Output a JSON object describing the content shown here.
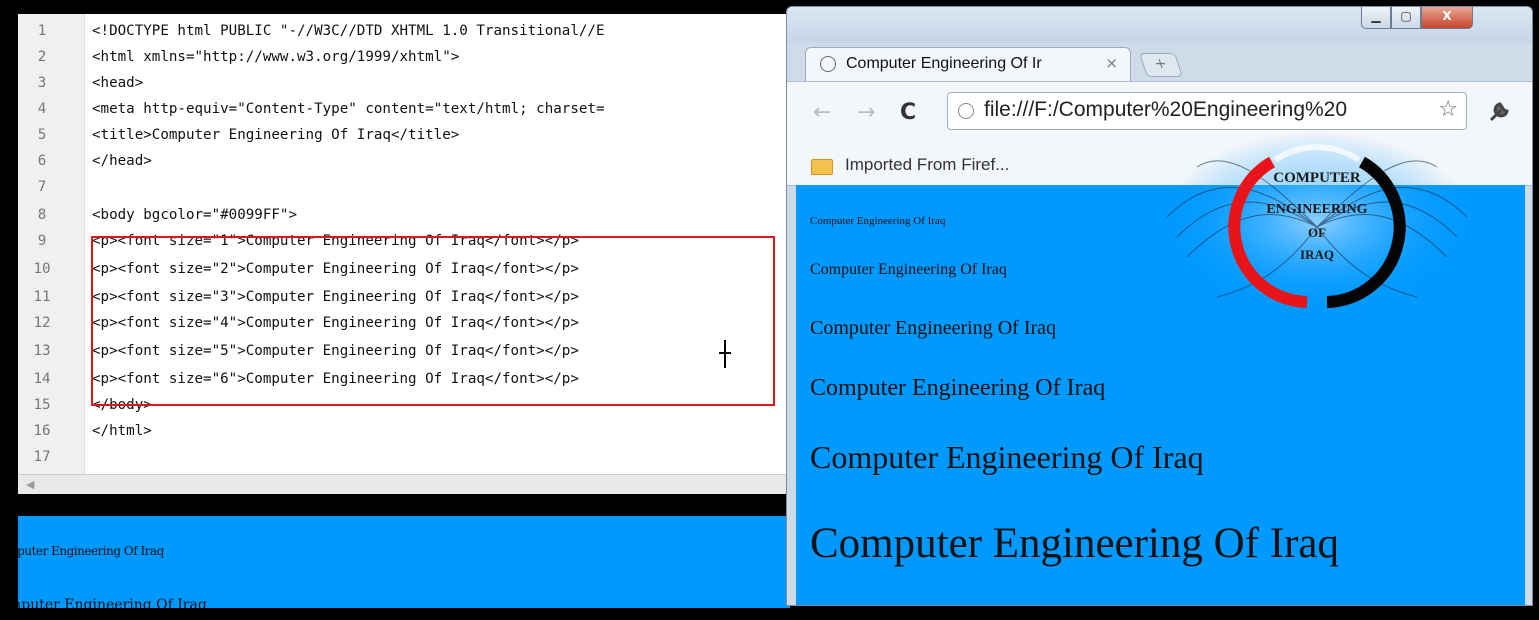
{
  "editor": {
    "lines": [
      {
        "num": "1",
        "text": "<!DOCTYPE html PUBLIC \"-//W3C//DTD XHTML 1.0 Transitional//E"
      },
      {
        "num": "2",
        "text": "<html xmlns=\"http://www.w3.org/1999/xhtml\">"
      },
      {
        "num": "3",
        "text": "<head>"
      },
      {
        "num": "4",
        "text": "<meta http-equiv=\"Content-Type\" content=\"text/html; charset="
      },
      {
        "num": "5",
        "text": "<title>Computer Engineering Of Iraq</title>"
      },
      {
        "num": "6",
        "text": "</head>"
      },
      {
        "num": "7",
        "text": ""
      },
      {
        "num": "8",
        "text": "<body bgcolor=\"#0099FF\">"
      },
      {
        "num": "9",
        "text": "<p><font size=\"1\">Computer Engineering Of Iraq</font></p>"
      },
      {
        "num": "10",
        "text": "<p><font size=\"2\">Computer Engineering Of Iraq</font></p>"
      },
      {
        "num": "11",
        "text": "<p><font size=\"3\">Computer Engineering Of Iraq</font></p>"
      },
      {
        "num": "12",
        "text": "<p><font size=\"4\">Computer Engineering Of Iraq</font></p>"
      },
      {
        "num": "13",
        "text": "<p><font size=\"5\">Computer Engineering Of Iraq</font></p>"
      },
      {
        "num": "14",
        "text": "<p><font size=\"6\">Computer Engineering Of Iraq</font></p>"
      },
      {
        "num": "15",
        "text": "</body>"
      },
      {
        "num": "16",
        "text": "</html>"
      },
      {
        "num": "17",
        "text": ""
      }
    ],
    "scroll_left_icon": "scroll-left-arrow"
  },
  "preview": {
    "line_small": "nputer Engineering Of Iraq",
    "line_medium": "mputer Engineering Of Iraq"
  },
  "browser": {
    "window_buttons": {
      "minimize": "minimize-icon",
      "maximize": "maximize-icon",
      "close": "close-icon"
    },
    "close_label": "X",
    "tab_title": "Computer Engineering Of Ir",
    "tab_close": "×",
    "new_tab": "+",
    "back": "←",
    "forward": "→",
    "reload": "C",
    "url": "file:///F:/Computer%20Engineering%20",
    "star": "☆",
    "wrench": "🔧",
    "bookmark_label": "Imported From Firef...",
    "page_lines": [
      "Computer Engineering Of Iraq",
      "Computer Engineering Of Iraq",
      "Computer Engineering Of Iraq",
      "Computer Engineering Of Iraq",
      "Computer Engineering Of Iraq",
      "Computer Engineering Of Iraq"
    ],
    "logo": {
      "line1": "Computer",
      "line2": "Engineering",
      "line3": "Of",
      "line4": "Iraq"
    }
  },
  "colors": {
    "page_bg": "#0099ff",
    "highlight": "#d8191b"
  }
}
